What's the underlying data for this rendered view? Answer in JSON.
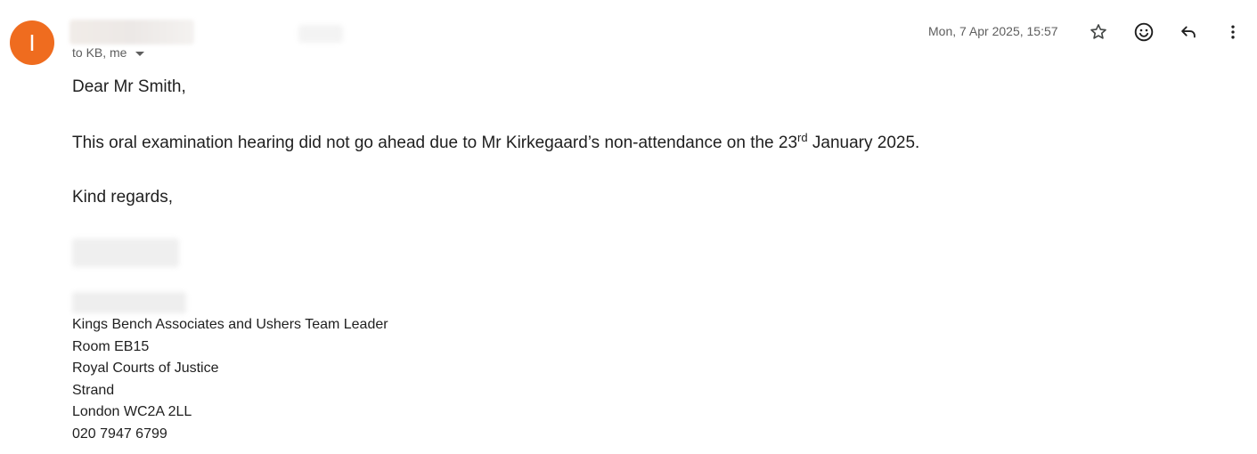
{
  "sender": {
    "avatar_letter": "I",
    "avatar_color": "#ef6c1f"
  },
  "header": {
    "recipients": "to KB, me",
    "timestamp": "Mon, 7 Apr 2025, 15:57"
  },
  "actions": {
    "star_icon": "star-icon",
    "emoji_icon": "emoji-icon",
    "reply_icon": "reply-icon",
    "more_icon": "more-vert-icon"
  },
  "message": {
    "greeting": "Dear Mr Smith,",
    "line_before_sup": "This oral examination hearing did not go ahead due to Mr Kirkegaard’s non-attendance on the 23",
    "line_sup": "rd",
    "line_after_sup": " January 2025.",
    "closing": "Kind regards,"
  },
  "signature": {
    "lines": [
      "Kings Bench Associates and Ushers Team Leader",
      "Room EB15",
      "Royal Courts of Justice",
      "Strand",
      "London WC2A 2LL",
      "020 7947 6799"
    ]
  }
}
